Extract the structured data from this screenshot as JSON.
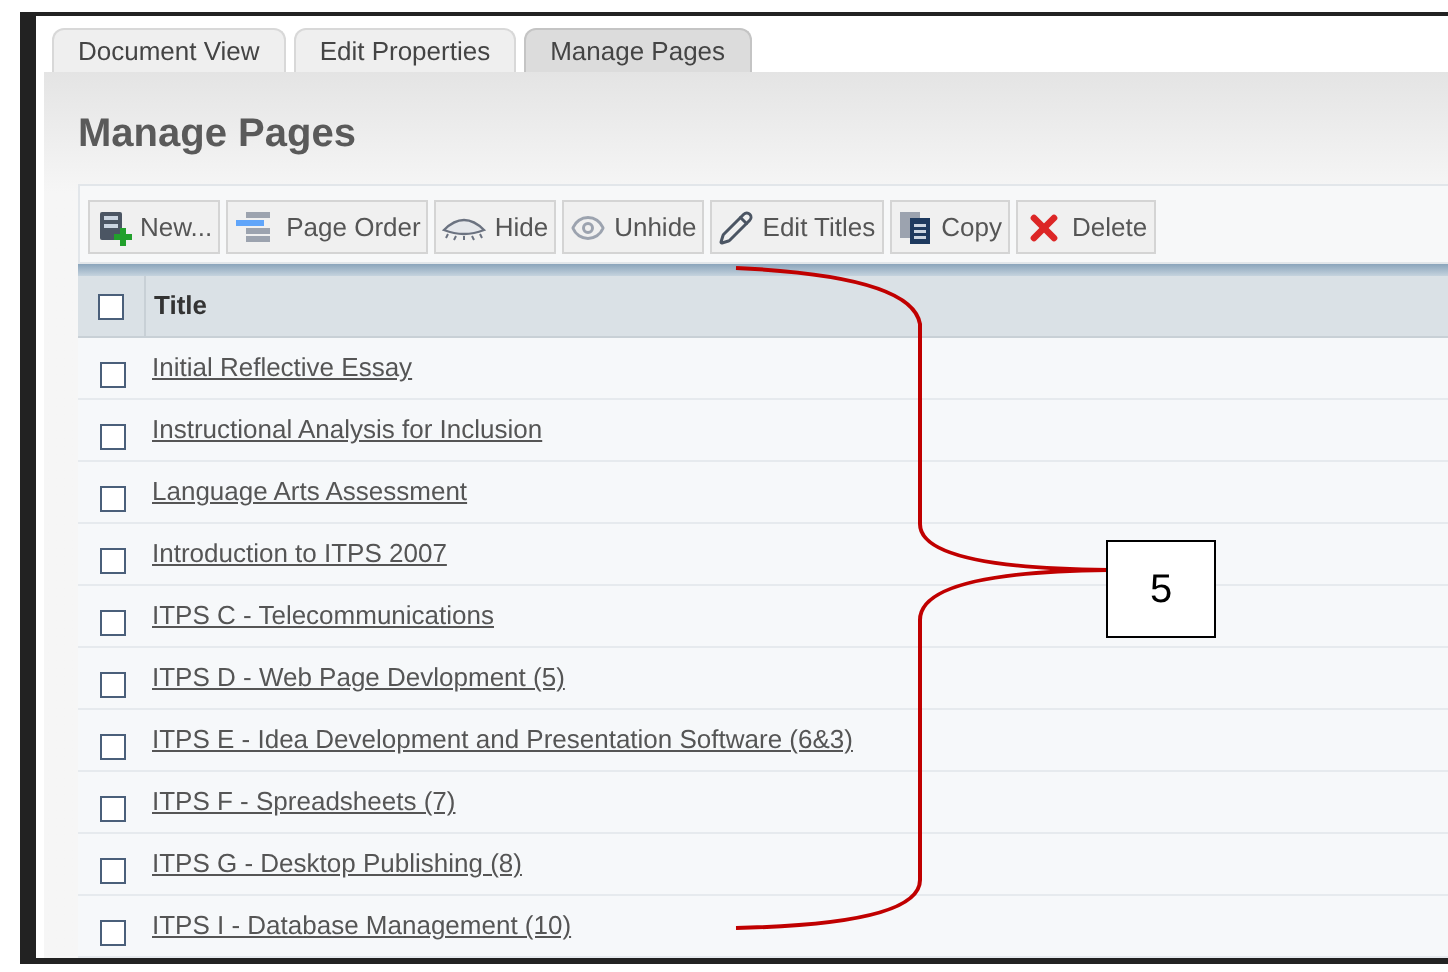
{
  "tabs": [
    {
      "label": "Document View",
      "selected": false
    },
    {
      "label": "Edit Properties",
      "selected": false
    },
    {
      "label": "Manage Pages",
      "selected": true
    }
  ],
  "heading": "Manage Pages",
  "toolbar": [
    {
      "kind": "new",
      "label": "New..."
    },
    {
      "kind": "order",
      "label": "Page Order"
    },
    {
      "kind": "hide",
      "label": "Hide"
    },
    {
      "kind": "unhide",
      "label": "Unhide"
    },
    {
      "kind": "edit",
      "label": "Edit Titles"
    },
    {
      "kind": "copy",
      "label": "Copy"
    },
    {
      "kind": "delete",
      "label": "Delete"
    }
  ],
  "table": {
    "header": {
      "label": "Title",
      "checked": false
    },
    "rows": [
      {
        "title": "Initial Reflective Essay",
        "checked": false
      },
      {
        "title": "Instructional Analysis for Inclusion",
        "checked": false
      },
      {
        "title": "Language Arts Assessment",
        "checked": false
      },
      {
        "title": "Introduction to ITPS 2007",
        "checked": false
      },
      {
        "title": "ITPS C - Telecommunications",
        "checked": false
      },
      {
        "title": "ITPS D - Web Page Devlopment (5)",
        "checked": false
      },
      {
        "title": "ITPS E - Idea Development and Presentation Software (6&3)",
        "checked": false
      },
      {
        "title": "ITPS F - Spreadsheets (7)",
        "checked": false
      },
      {
        "title": "ITPS G - Desktop Publishing (8)",
        "checked": false
      },
      {
        "title": "ITPS I - Database Management (10)",
        "checked": false
      }
    ]
  },
  "callout": {
    "label": "5"
  }
}
